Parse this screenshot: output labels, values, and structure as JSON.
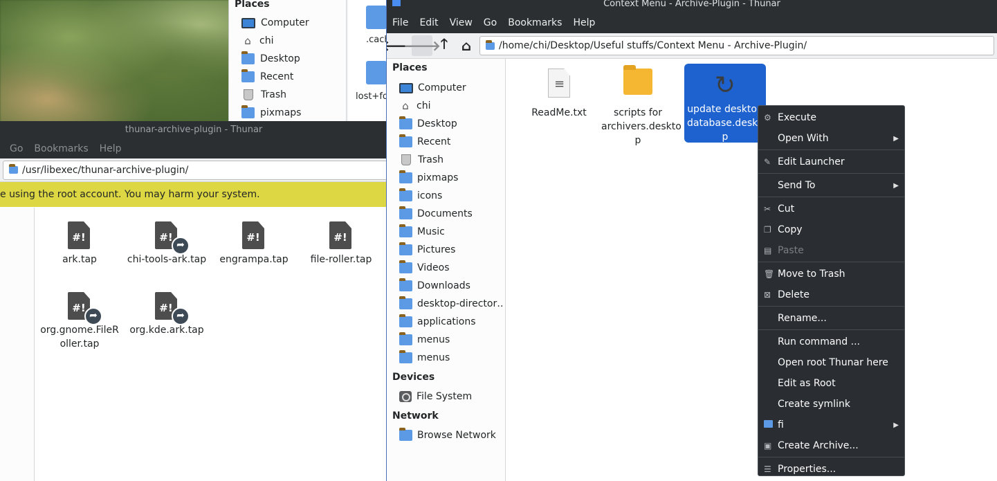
{
  "top_window": {
    "places_header": "Places",
    "places": [
      {
        "label": "Computer",
        "icon": "computer-icon"
      },
      {
        "label": "chi",
        "icon": "home-icon"
      },
      {
        "label": "Desktop",
        "icon": "folder-icon"
      },
      {
        "label": "Recent",
        "icon": "folder-icon"
      },
      {
        "label": "Trash",
        "icon": "trash-icon"
      },
      {
        "label": "pixmaps",
        "icon": "folder-icon"
      }
    ],
    "files": [
      ".cach",
      "lost+fo"
    ]
  },
  "left_window": {
    "title": "thunar-archive-plugin - Thunar",
    "menu": [
      "Go",
      "Bookmarks",
      "Help"
    ],
    "path": "/usr/libexec/thunar-archive-plugin/",
    "warning": "e using the root account. You may harm your system.",
    "files": [
      {
        "name": "ark.tap",
        "link": false
      },
      {
        "name": "chi-tools-ark.tap",
        "link": true
      },
      {
        "name": "engrampa.tap",
        "link": false
      },
      {
        "name": "file-roller.tap",
        "link": false
      },
      {
        "name": "org.gnome.FileR oller.tap",
        "link": true
      },
      {
        "name": "org.kde.ark.tap",
        "link": true
      }
    ],
    "tap_glyph": "#!"
  },
  "main_window": {
    "title": "Context Menu - Archive-Plugin - Thunar",
    "menu": [
      "File",
      "Edit",
      "View",
      "Go",
      "Bookmarks",
      "Help"
    ],
    "path": "/home/chi/Desktop/Useful stuffs/Context Menu - Archive-Plugin/",
    "toolbar": {
      "back": "🡐",
      "forward": "🡒",
      "up": "🡑",
      "home": "⌂"
    },
    "sidebar": {
      "places_header": "Places",
      "places": [
        {
          "label": "Computer",
          "icon": "computer-icon"
        },
        {
          "label": "chi",
          "icon": "home-icon"
        },
        {
          "label": "Desktop",
          "icon": "folder-icon"
        },
        {
          "label": "Recent",
          "icon": "recent-folder-icon"
        },
        {
          "label": "Trash",
          "icon": "trash-icon"
        },
        {
          "label": "pixmaps",
          "icon": "folder-icon"
        },
        {
          "label": "icons",
          "icon": "folder-icon"
        },
        {
          "label": "Documents",
          "icon": "documents-folder-icon"
        },
        {
          "label": "Music",
          "icon": "music-folder-icon"
        },
        {
          "label": "Pictures",
          "icon": "pictures-folder-icon"
        },
        {
          "label": "Videos",
          "icon": "videos-folder-icon"
        },
        {
          "label": "Downloads",
          "icon": "downloads-folder-icon"
        },
        {
          "label": "desktop-director…",
          "icon": "folder-icon"
        },
        {
          "label": "applications",
          "icon": "folder-icon"
        },
        {
          "label": "menus",
          "icon": "folder-icon"
        },
        {
          "label": "menus",
          "icon": "folder-icon"
        }
      ],
      "devices_header": "Devices",
      "devices": [
        {
          "label": "File System",
          "icon": "drive-icon"
        }
      ],
      "network_header": "Network",
      "network": [
        {
          "label": "Browse Network",
          "icon": "network-folder-icon"
        }
      ]
    },
    "files": [
      {
        "name": "ReadMe.txt",
        "icon": "text-file-icon",
        "selected": false
      },
      {
        "name": "scripts for archivers.desktop",
        "icon": "folder-icon",
        "selected": false
      },
      {
        "name": "update desktop database.desktop",
        "icon": "refresh-icon",
        "selected": true
      }
    ],
    "file_labels": {
      "readme": "ReadMe.txt",
      "scripts": "scripts for archivers.deskto p",
      "update": "update desktop database.deskto p"
    }
  },
  "context_menu": {
    "execute": "Execute",
    "open_with": "Open With",
    "edit_launcher": "Edit Launcher",
    "send_to": "Send To",
    "cut": "Cut",
    "copy": "Copy",
    "paste": "Paste",
    "move_to_trash": "Move to Trash",
    "delete": "Delete",
    "rename": "Rename...",
    "run_command": "Run command ...",
    "open_root": "Open root Thunar here",
    "edit_as_root": "Edit as Root",
    "create_symlink": "Create symlink",
    "fi": "fi",
    "create_archive": "Create Archive...",
    "properties": "Properties..."
  },
  "colors": {
    "accent": "#1e62d0",
    "titlebar": "#2b2f32",
    "warning": "#dcd742",
    "menu_bg": "#2a2e32"
  }
}
